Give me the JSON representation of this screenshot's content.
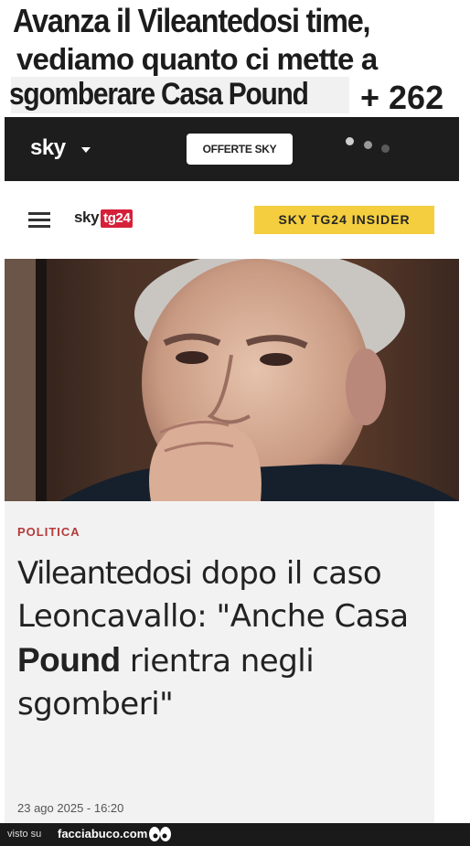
{
  "caption": {
    "line1": "Avanza il Vileantedosi time,",
    "line2": "vediamo quanto ci mette a",
    "line3": "sgomberare Casa Pound",
    "counter": "+ 262"
  },
  "sky_header": {
    "logo": "sky",
    "offer_button": "OFFERTE SKY",
    "colors": {
      "background": "#1d1d1d"
    }
  },
  "tg_header": {
    "logo_text": "sky",
    "logo_badge": "tg24",
    "insider_button": "SKY TG24 INSIDER",
    "colors": {
      "insider": "#f4ce3e",
      "badge": "#d6203a"
    }
  },
  "article": {
    "category": "POLITICA",
    "headline_part1": "Vileantedosi",
    "headline_part2": "dopo il caso Leoncavallo: \"Anche Casa",
    "headline_pound": "Pound",
    "headline_part3": "rientra negli sgomberi\"",
    "date": "23 ago 2025 - 16:20"
  },
  "footer": {
    "visto_su": "visto su",
    "site": "facciabuco.com"
  }
}
